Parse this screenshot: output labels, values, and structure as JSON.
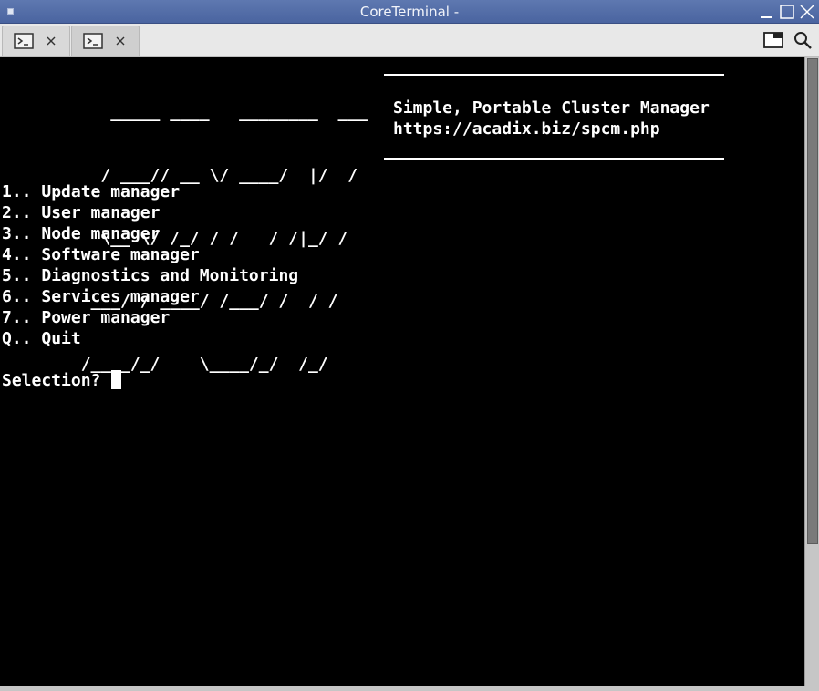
{
  "window": {
    "title": "CoreTerminal -"
  },
  "tabs": [
    {
      "icon": "terminal-icon",
      "active": false
    },
    {
      "icon": "terminal-icon",
      "active": true
    }
  ],
  "ascii_logo": [
    "           _____ ____   ________  ___",
    "          / ___// __ \\/ ____/  |/  /",
    "          \\__ \\/ /_/ / /   / /|_/ /",
    "         ___/ / ____/ /___/ /  / /",
    "        /____/_/    \\____/_/  /_/"
  ],
  "banner": {
    "line1": "Simple, Portable Cluster Manager",
    "line2": "https://acadix.biz/spcm.php"
  },
  "menu": [
    {
      "key": "1..",
      "label": "Update manager"
    },
    {
      "key": "2..",
      "label": "User manager"
    },
    {
      "key": "3..",
      "label": "Node manager"
    },
    {
      "key": "4..",
      "label": "Software manager"
    },
    {
      "key": "5..",
      "label": "Diagnostics and Monitoring"
    },
    {
      "key": "6..",
      "label": "Services manager"
    },
    {
      "key": "7..",
      "label": "Power manager"
    },
    {
      "key": "Q..",
      "label": "Quit"
    }
  ],
  "prompt": "Selection? "
}
